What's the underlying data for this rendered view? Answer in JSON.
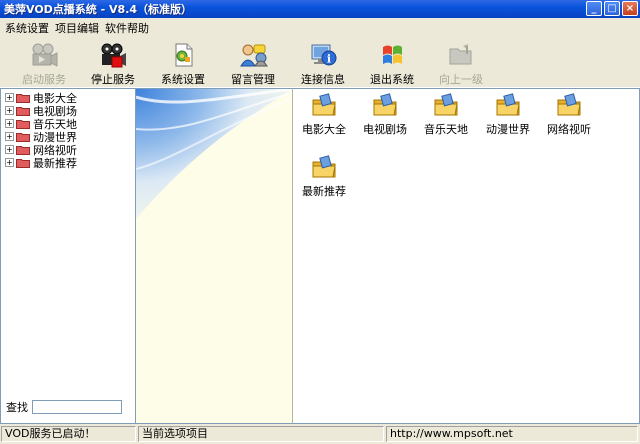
{
  "window": {
    "title": "美萍VOD点播系统 - V8.4（标准版）",
    "buttons": {
      "minimize": "_",
      "maximize": "□",
      "close": "×"
    }
  },
  "menu": [
    {
      "label": "系统设置"
    },
    {
      "label": "项目编辑"
    },
    {
      "label": "软件帮助"
    }
  ],
  "toolbar": [
    {
      "label": "启动服务",
      "icon": "play-projector-icon",
      "enabled": false
    },
    {
      "label": "停止服务",
      "icon": "stop-projector-icon",
      "enabled": true
    },
    {
      "label": "系统设置",
      "icon": "settings-icon",
      "enabled": true
    },
    {
      "label": "留言管理",
      "icon": "message-icon",
      "enabled": true
    },
    {
      "label": "连接信息",
      "icon": "info-icon",
      "enabled": true
    },
    {
      "label": "退出系统",
      "icon": "exit-icon",
      "enabled": true
    },
    {
      "label": "向上一级",
      "icon": "up-folder-icon",
      "enabled": false
    }
  ],
  "tree": {
    "expander": "+",
    "items": [
      {
        "label": "电影大全"
      },
      {
        "label": "电视剧场"
      },
      {
        "label": "音乐天地"
      },
      {
        "label": "动漫世界"
      },
      {
        "label": "网络视听"
      },
      {
        "label": "最新推荐"
      }
    ]
  },
  "search": {
    "label": "查找",
    "value": ""
  },
  "content": {
    "folders": [
      {
        "label": "电影大全"
      },
      {
        "label": "电视剧场"
      },
      {
        "label": "音乐天地"
      },
      {
        "label": "动漫世界"
      },
      {
        "label": "网络视听"
      },
      {
        "label": "最新推荐"
      }
    ]
  },
  "status": {
    "service": "VOD服务已启动！",
    "selection": "当前选项项目",
    "url": "http://www.mpsoft.net"
  },
  "colors": {
    "titlebar": "#0A53DC",
    "folder": "#F6C544",
    "tree_folder": "#D9534F",
    "panel_bg": "#ECE9D8"
  }
}
